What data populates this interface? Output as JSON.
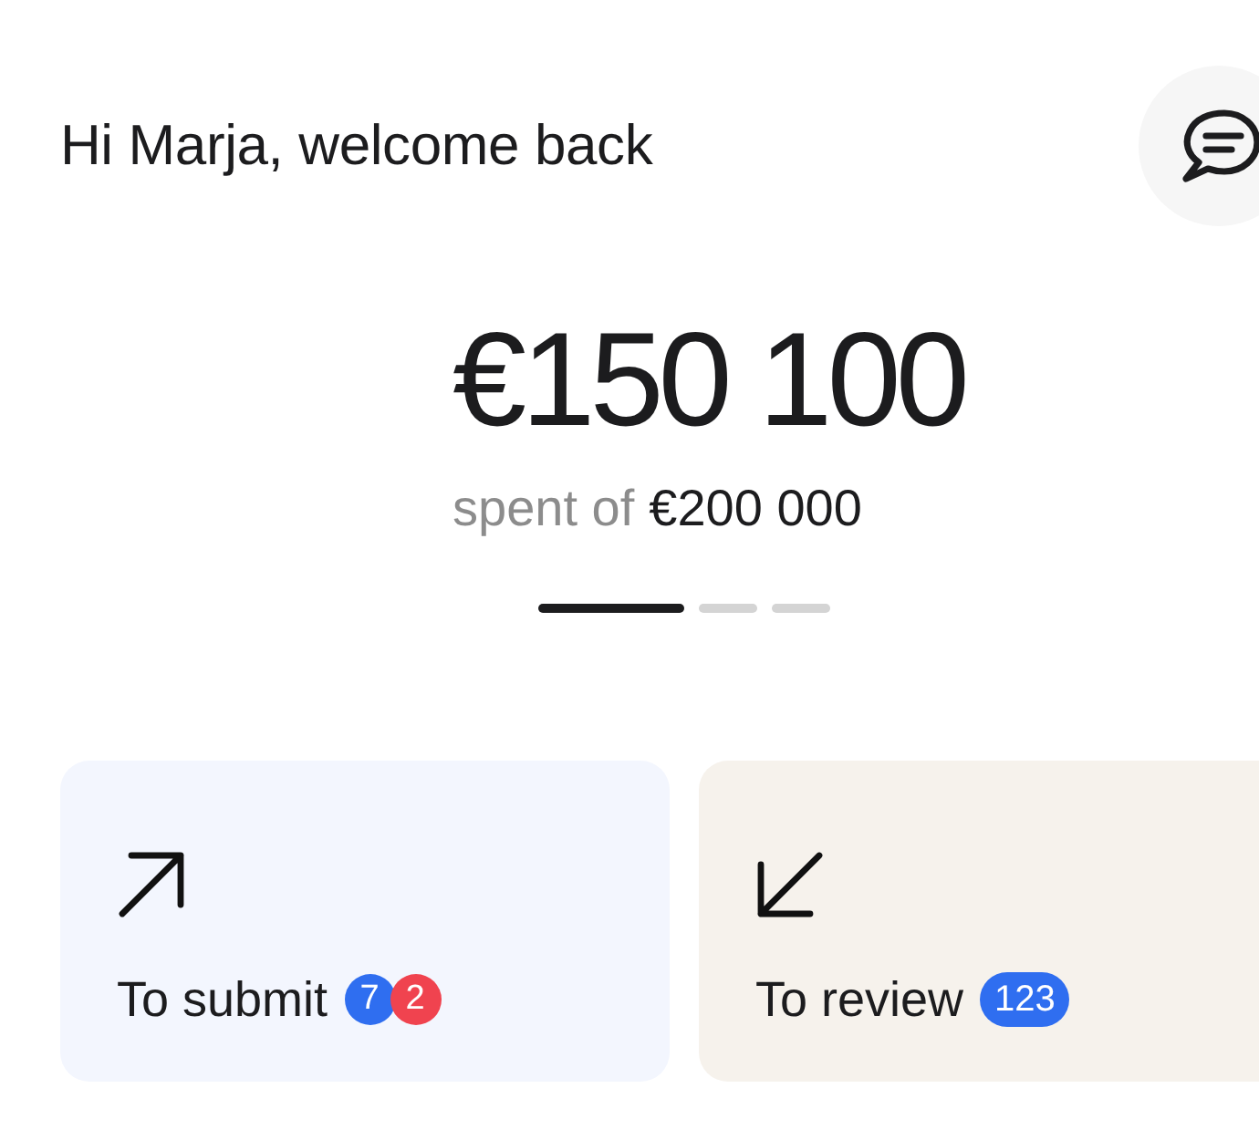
{
  "header": {
    "greeting": "Hi Marja, welcome back"
  },
  "summary": {
    "amount": "€150 100",
    "spent_label": "spent of",
    "budget": "€200 000"
  },
  "pager": [
    {
      "selected": true
    },
    {
      "selected": false
    },
    {
      "selected": false
    }
  ],
  "tasks": [
    {
      "kind": "outgoing",
      "label": "To submit",
      "color": "#f3f6fe",
      "badges": [
        {
          "text": "7",
          "color": "#2f6ef0"
        },
        {
          "text": "2",
          "color": "#f0434f"
        }
      ]
    },
    {
      "kind": "incoming",
      "label": "To review",
      "color": "#f6f2ec",
      "badges": [
        {
          "text": "123",
          "color": "#2f6ef0"
        }
      ]
    }
  ]
}
